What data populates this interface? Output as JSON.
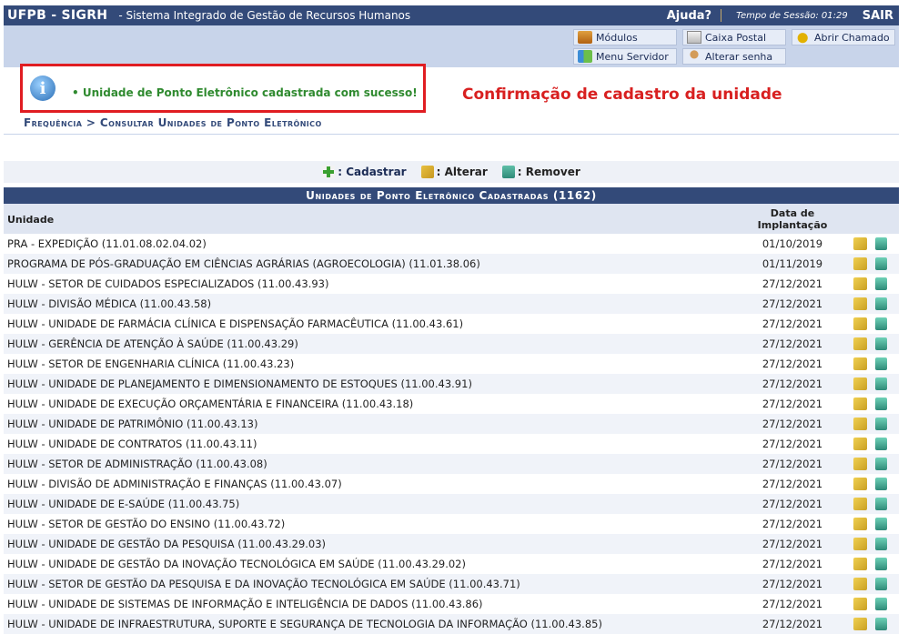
{
  "header": {
    "system": "UFPB - SIGRH",
    "system_name": "- Sistema Integrado de Gestão de Recursos Humanos",
    "help": "Ajuda?",
    "session": "Tempo de Sessão: 01:29",
    "exit": "SAIR"
  },
  "menu": {
    "modulos": "Módulos",
    "caixa_postal": "Caixa Postal",
    "abrir_chamado": "Abrir Chamado",
    "menu_servidor": "Menu Servidor",
    "alterar_senha": "Alterar senha"
  },
  "message": {
    "success": "• Unidade de Ponto Eletrônico cadastrada com sucesso!",
    "annotation": "Confirmação de cadastro da unidade"
  },
  "breadcrumb": "Frequência > Consultar Unidades de Ponto Eletrônico",
  "toolbar": {
    "add": ": Cadastrar",
    "edit": ": Alterar",
    "remove": ": Remover"
  },
  "table": {
    "caption": "Unidades de Ponto Eletrônico Cadastradas (1162)",
    "col_unit": "Unidade",
    "col_date_line1": "Data de",
    "col_date_line2": "Implantação",
    "rows": [
      {
        "unit": "PRA - EXPEDIÇÃO (11.01.08.02.04.02)",
        "date": "01/10/2019"
      },
      {
        "unit": "PROGRAMA DE PÓS-GRADUAÇÃO EM CIÊNCIAS AGRÁRIAS (AGROECOLOGIA) (11.01.38.06)",
        "date": "01/11/2019"
      },
      {
        "unit": "HULW - SETOR DE CUIDADOS ESPECIALIZADOS (11.00.43.93)",
        "date": "27/12/2021"
      },
      {
        "unit": "HULW - DIVISÃO MÉDICA (11.00.43.58)",
        "date": "27/12/2021"
      },
      {
        "unit": "HULW - UNIDADE DE FARMÁCIA CLÍNICA E DISPENSAÇÃO FARMACÊUTICA (11.00.43.61)",
        "date": "27/12/2021"
      },
      {
        "unit": "HULW - GERÊNCIA DE ATENÇÃO À SAÚDE (11.00.43.29)",
        "date": "27/12/2021"
      },
      {
        "unit": "HULW - SETOR DE ENGENHARIA CLÍNICA (11.00.43.23)",
        "date": "27/12/2021"
      },
      {
        "unit": "HULW - UNIDADE DE PLANEJAMENTO E DIMENSIONAMENTO DE ESTOQUES (11.00.43.91)",
        "date": "27/12/2021"
      },
      {
        "unit": "HULW - UNIDADE DE EXECUÇÃO ORÇAMENTÁRIA E FINANCEIRA (11.00.43.18)",
        "date": "27/12/2021"
      },
      {
        "unit": "HULW - UNIDADE DE PATRIMÔNIO (11.00.43.13)",
        "date": "27/12/2021"
      },
      {
        "unit": "HULW - UNIDADE DE CONTRATOS (11.00.43.11)",
        "date": "27/12/2021"
      },
      {
        "unit": "HULW - SETOR DE ADMINISTRAÇÃO (11.00.43.08)",
        "date": "27/12/2021"
      },
      {
        "unit": "HULW - DIVISÃO DE ADMINISTRAÇÃO E FINANÇAS (11.00.43.07)",
        "date": "27/12/2021"
      },
      {
        "unit": "HULW - UNIDADE DE E-SAÚDE (11.00.43.75)",
        "date": "27/12/2021"
      },
      {
        "unit": "HULW - SETOR DE GESTÃO DO ENSINO (11.00.43.72)",
        "date": "27/12/2021"
      },
      {
        "unit": "HULW - UNIDADE DE GESTÃO DA PESQUISA (11.00.43.29.03)",
        "date": "27/12/2021"
      },
      {
        "unit": "HULW - UNIDADE DE GESTÃO DA INOVAÇÃO TECNOLÓGICA EM SAÚDE (11.00.43.29.02)",
        "date": "27/12/2021"
      },
      {
        "unit": "HULW - SETOR DE GESTÃO DA PESQUISA E DA INOVAÇÃO TECNOLÓGICA EM SAÚDE (11.00.43.71)",
        "date": "27/12/2021"
      },
      {
        "unit": "HULW - UNIDADE DE SISTEMAS DE INFORMAÇÃO E INTELIGÊNCIA DE DADOS (11.00.43.86)",
        "date": "27/12/2021"
      },
      {
        "unit": "HULW - UNIDADE DE INFRAESTRUTURA, SUPORTE E SEGURANÇA DE TECNOLOGIA DA INFORMAÇÃO (11.00.43.85)",
        "date": "27/12/2021"
      }
    ]
  }
}
